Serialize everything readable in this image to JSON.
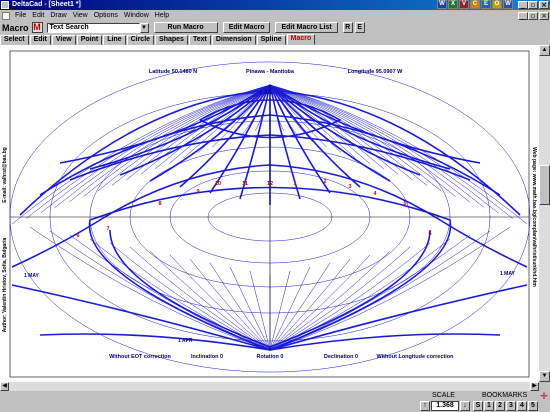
{
  "window": {
    "title": "DeltaCad - [Sheet1 *]"
  },
  "tray": [
    "W",
    "X",
    "V",
    "C",
    "E",
    "O",
    "W"
  ],
  "menu": [
    "File",
    "Edit",
    "Draw",
    "View",
    "Options",
    "Window",
    "Help"
  ],
  "toolbar": {
    "label": "Macro",
    "badge": "M",
    "combo_value": "Text Search",
    "buttons": [
      "Run Macro",
      "Edit Macro",
      "Edit Macro List"
    ],
    "square_buttons": [
      "R",
      "E"
    ]
  },
  "tabs": [
    "Select",
    "Edit",
    "View",
    "Point",
    "Line",
    "Circle",
    "Shapes",
    "Text",
    "Dimension",
    "Spline",
    "Macro"
  ],
  "active_tab": "Macro",
  "drawing": {
    "latitude": "Latitude 50.1480 N",
    "place": "Pinawa - Manitoba",
    "longitude": "Longitude 95.0907 W",
    "author": "Author: Valentin Hristov, Sofia, Bulgaria",
    "email": "E-mail: valhrst@bas.bg",
    "webpage": "Web page: www.math.bas.bg/complan/valhrist/sunkhd.htm",
    "eot": "Without EOT correction",
    "inclination": "Inclination 0",
    "rotation": "Rotation 0",
    "declination": "Declination 0",
    "longcorr": "Without Longitude correction",
    "hours": [
      "12",
      "1",
      "2",
      "3",
      "4",
      "5",
      "6",
      "11",
      "10",
      "9",
      "8",
      "7",
      "6"
    ],
    "months_left": [
      "1 MAY",
      "1 APR"
    ],
    "months_right": [
      "1 MAY"
    ],
    "top_label": "1 JUL"
  },
  "status": {
    "scale_label": "SCALE",
    "scale_value": "1.368",
    "bookmarks_label": "BOOKMARKS",
    "bookmarks": [
      "S",
      "1",
      "2",
      "3",
      "4",
      "5"
    ]
  },
  "colors": {
    "ink": "#1a1ad6",
    "hour_red": "#c00000",
    "title_blue": "#000080"
  }
}
